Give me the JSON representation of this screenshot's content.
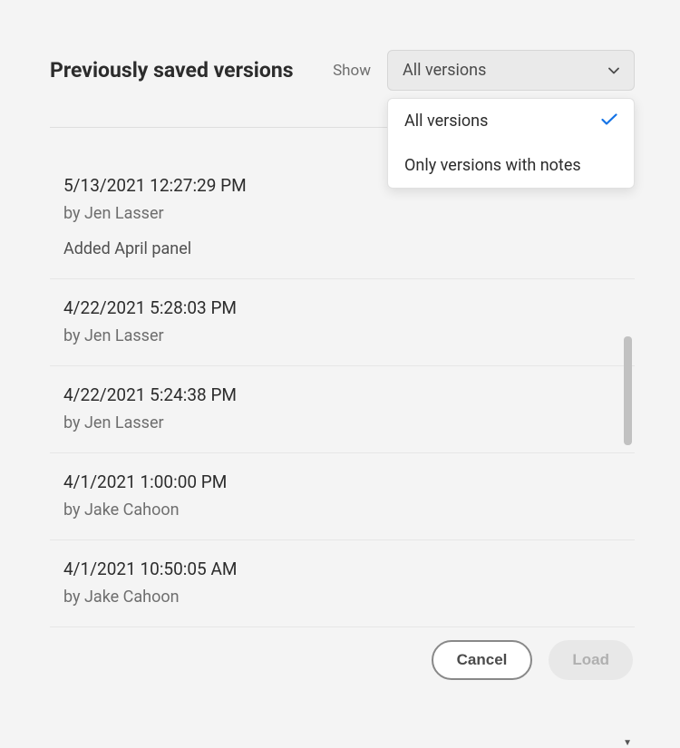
{
  "header": {
    "title": "Previously saved versions",
    "show_label": "Show"
  },
  "dropdown": {
    "selected": "All versions",
    "options": [
      {
        "label": "All versions",
        "selected": true
      },
      {
        "label": "Only versions with notes",
        "selected": false
      }
    ]
  },
  "versions": [
    {
      "timestamp": "5/13/2021 12:27:29 PM",
      "author": "by Jen Lasser",
      "note": "Added April panel"
    },
    {
      "timestamp": "4/22/2021 5:28:03 PM",
      "author": "by Jen Lasser"
    },
    {
      "timestamp": "4/22/2021 5:24:38 PM",
      "author": "by Jen Lasser"
    },
    {
      "timestamp": "4/1/2021 1:00:00 PM",
      "author": "by Jake Cahoon"
    },
    {
      "timestamp": "4/1/2021 10:50:05 AM",
      "author": "by Jake Cahoon"
    }
  ],
  "buttons": {
    "cancel": "Cancel",
    "load": "Load"
  }
}
